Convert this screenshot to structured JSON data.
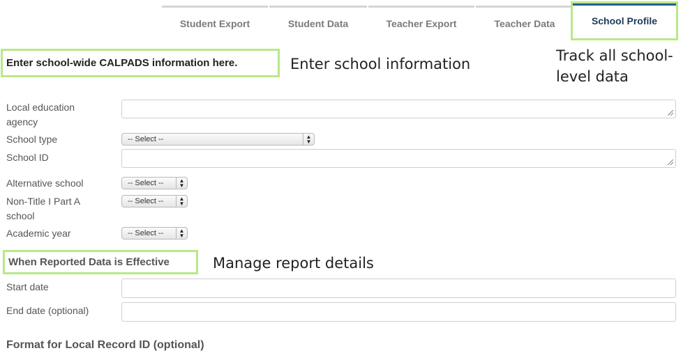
{
  "tabs": [
    {
      "label": "Student Export"
    },
    {
      "label": "Student Data"
    },
    {
      "label": "Teacher Export"
    },
    {
      "label": "Teacher Data"
    },
    {
      "label": "School Profile",
      "active": true
    }
  ],
  "headings": {
    "calpads": "Enter school-wide CALPADS information here.",
    "effective": "When Reported Data is Effective",
    "format": "Format for Local Record ID  (optional)"
  },
  "annotations": {
    "enter_info": "Enter school information",
    "track_line1": "Track all school-",
    "track_line2": "level data",
    "manage": "Manage report details"
  },
  "fields": {
    "lea_line1": "Local education",
    "lea_line2": "agency",
    "school_type": "School type",
    "school_id": "School ID",
    "alternative_school": "Alternative school",
    "nontitle_line1": "Non-Title I Part A",
    "nontitle_line2": "school",
    "academic_year": "Academic year",
    "start_date": "Start date",
    "end_date": "End date  (optional)"
  },
  "selects": {
    "school_type": "-- Select --",
    "alternative_school": "-- Select --",
    "nontitle": "-- Select --",
    "academic_year": "-- Select --"
  },
  "colors": {
    "highlight": "#b8e986",
    "active_tab_bar": "#1f5f8b",
    "active_tab_text": "#1d3a56"
  }
}
